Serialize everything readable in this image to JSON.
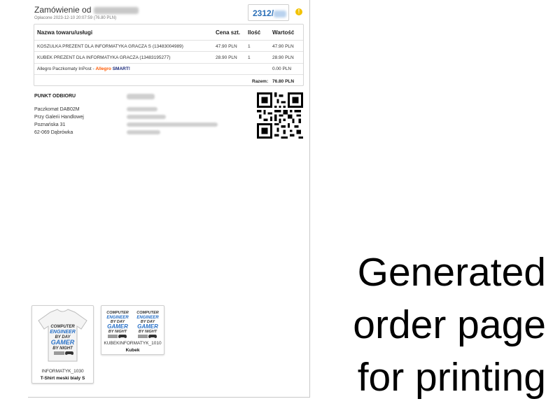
{
  "order": {
    "title_prefix": "Zamówienie od",
    "paid_text": "Opłacone 2023-12-10 20:07:59 (76.80 PLN)",
    "number_prefix": "2312/",
    "note_icon": "info-icon"
  },
  "table": {
    "headers": [
      "Nazwa towaru/usługi",
      "Cena szt.",
      "Ilość",
      "Wartość"
    ],
    "rows": [
      {
        "name": "KOSZULKA PREZENT DLA INFORMATYKA GRACZA S (13483004989)",
        "price": "47.90 PLN",
        "qty": "1",
        "value": "47.90 PLN"
      },
      {
        "name": "KUBEK PREZENT DLA INFORMATYKA GRACZA (13483195277)",
        "price": "28.90 PLN",
        "qty": "1",
        "value": "28.90 PLN"
      }
    ],
    "shipping": {
      "name": "Allegro Paczkomaty InPost -",
      "brand": "Allegro",
      "smart": "SMART!",
      "value": "0.00 PLN"
    },
    "total_label": "Razem:",
    "total_value": "76.80 PLN"
  },
  "pickup": {
    "title": "PUNKT ODBIORU",
    "lines": [
      "Paczkomat DAB02M",
      "Przy Galerii Handlowej",
      "Poznańska 31",
      "62-069 Dąbrówka"
    ]
  },
  "products": [
    {
      "sku": "INFORMATYK_1030",
      "name": "T-Shirt meski bialy S"
    },
    {
      "sku": "KUBEKINFORMATYK_1010",
      "name": "Kubek"
    }
  ],
  "print_text": {
    "line1": "COMPUTER",
    "line2": "ENGINEER",
    "line3": "BY DAY",
    "line4": "GAMER",
    "line5": "BY NIGHT"
  },
  "caption": {
    "line1": "Generated",
    "line2": "order page",
    "line3": "for printing"
  }
}
